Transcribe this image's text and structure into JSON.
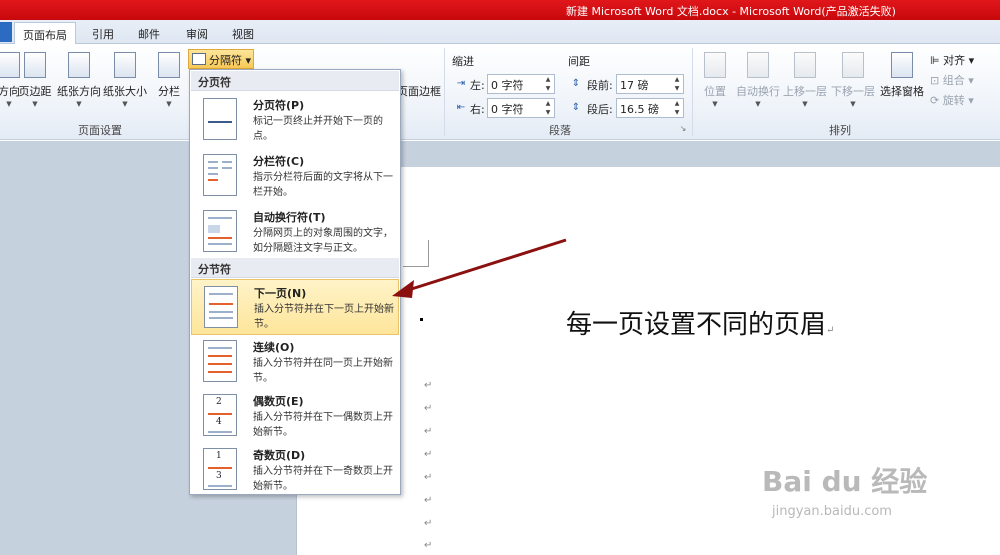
{
  "window": {
    "title": "新建 Microsoft Word 文档.docx - Microsoft Word(产品激活失败)"
  },
  "tabs": [
    {
      "label": "页面布局",
      "active": true
    },
    {
      "label": "引用"
    },
    {
      "label": "邮件"
    },
    {
      "label": "审阅"
    },
    {
      "label": "视图"
    }
  ],
  "ribbon": {
    "page_setup": {
      "label": "页面设置",
      "buttons": [
        "方向",
        "页边距",
        "纸张方向",
        "纸张大小",
        "分栏"
      ],
      "separator_button": "分隔符",
      "page_border": "页面边框"
    },
    "paragraph": {
      "label": "段落",
      "indent_title": "缩进",
      "spacing_title": "间距",
      "left_label": "左:",
      "left_value": "0 字符",
      "right_label": "右:",
      "right_value": "0 字符",
      "before_label": "段前:",
      "before_value": "17 磅",
      "after_label": "段后:",
      "after_value": "16.5 磅"
    },
    "arrange": {
      "label": "排列",
      "buttons": [
        "位置",
        "自动换行",
        "上移一层",
        "下移一层",
        "选择窗格"
      ],
      "align": "对齐",
      "group": "组合",
      "rotate": "旋转"
    }
  },
  "dropdown": {
    "section1_header": "分页符",
    "section2_header": "分节符",
    "items": [
      {
        "title": "分页符(P)",
        "desc": "标记一页终止并开始下一页的点。"
      },
      {
        "title": "分栏符(C)",
        "desc": "指示分栏符后面的文字将从下一栏开始。"
      },
      {
        "title": "自动换行符(T)",
        "desc": "分隔网页上的对象周围的文字，如分隔题注文字与正文。"
      },
      {
        "title": "下一页(N)",
        "desc": "插入分节符并在下一页上开始新节。"
      },
      {
        "title": "连续(O)",
        "desc": "插入分节符并在同一页上开始新节。"
      },
      {
        "title": "偶数页(E)",
        "desc": "插入分节符并在下一偶数页上开始新节。"
      },
      {
        "title": "奇数页(D)",
        "desc": "插入分节符并在下一奇数页上开始新节。"
      }
    ],
    "even_icon_numbers": [
      "2",
      "4"
    ],
    "odd_icon_numbers": [
      "1",
      "3"
    ]
  },
  "document": {
    "heading": "每一页设置不同的页眉",
    "paragraph_mark": "↵"
  },
  "watermark": {
    "main": "Bai du 经验",
    "url": "jingyan.baidu.com"
  },
  "colors": {
    "titlebar": "#d5121a",
    "highlight": "#fde59a",
    "arrow": "#8b1010"
  }
}
